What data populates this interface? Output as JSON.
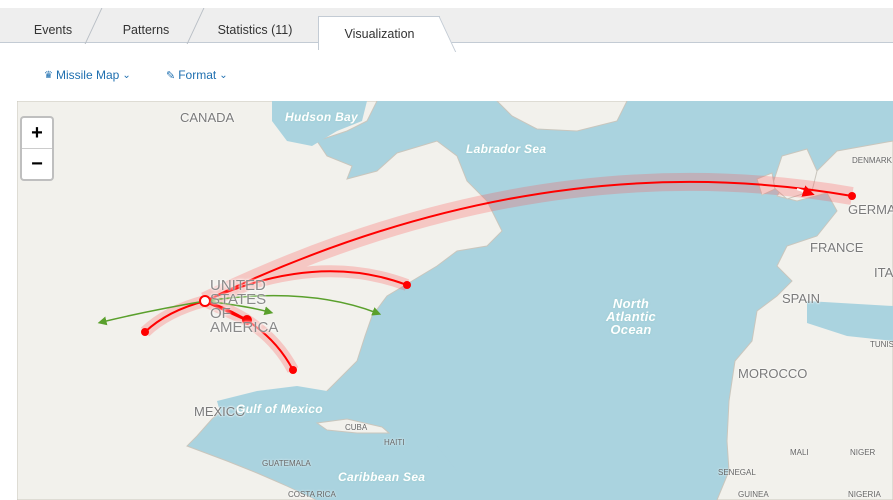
{
  "tabs": [
    {
      "label": "Events"
    },
    {
      "label": "Patterns"
    },
    {
      "label": "Statistics (11)"
    },
    {
      "label": "Visualization"
    }
  ],
  "toolbar": {
    "viz_icon": "map-marker-icon",
    "viz_label": "Missile Map",
    "format_icon": "pencil-icon",
    "format_label": "Format"
  },
  "map": {
    "zoom_in": "+",
    "zoom_out": "−",
    "labels": {
      "canada": "CANADA",
      "hudson_bay": "Hudson Bay",
      "labrador_sea": "Labrador Sea",
      "united_states": "UNITED STATES OF AMERICA",
      "north_atlantic": "North Atlantic Ocean",
      "mexico": "MEXICO",
      "gulf_of_mexico": "Gulf of Mexico",
      "cuba": "CUBA",
      "haiti": "HAITI",
      "guatemala": "GUATEMALA",
      "caribbean": "Caribbean Sea",
      "costa_rica": "COSTA RICA",
      "denmark": "DENMARK",
      "germany": "GERMANY",
      "france": "FRANCE",
      "italy": "ITALY",
      "spain": "SPAIN",
      "tunisia": "TUNISIA",
      "morocco": "MOROCCO",
      "mali": "MALI",
      "niger": "NIGER",
      "senegal": "SENEGAL",
      "guinea": "GUINEA",
      "nigeria": "NIGERIA"
    },
    "colors": {
      "attack": "#ff0000",
      "normal": "#5aa02c",
      "water": "#aad3df",
      "land": "#f2f1ec"
    }
  }
}
